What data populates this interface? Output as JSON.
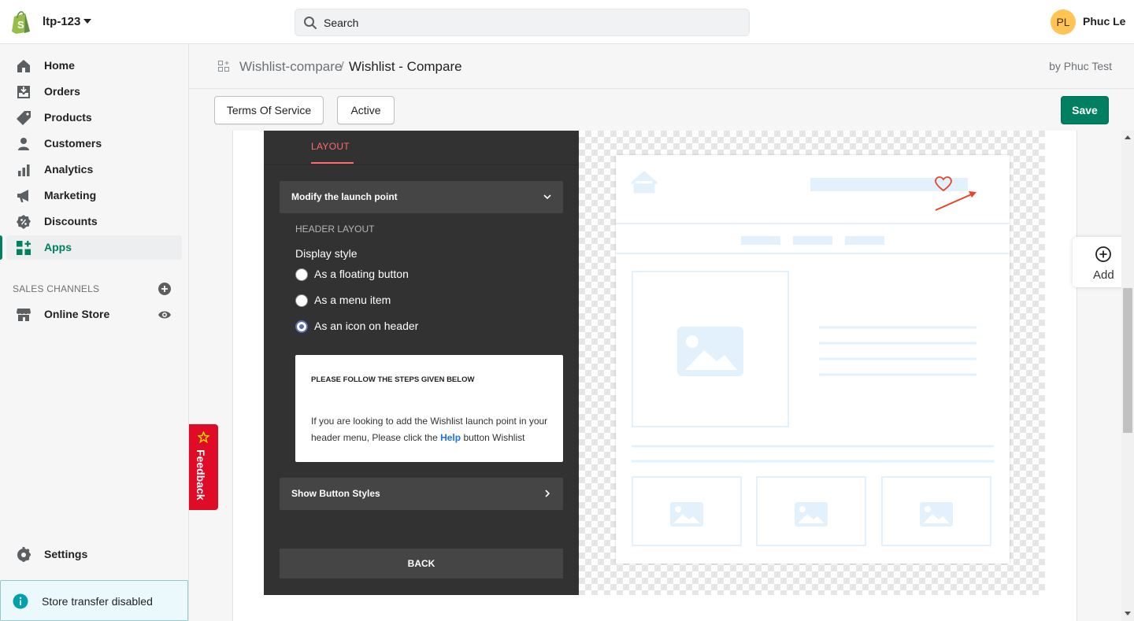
{
  "topbar": {
    "store_name": "ltp-123",
    "search_placeholder": "Search",
    "avatar_initials": "PL",
    "user_name": "Phuc Le",
    "icons": [
      "shopify-logo-icon",
      "caret-down-icon",
      "search-icon"
    ]
  },
  "sidebar": {
    "items": [
      {
        "label": "Home",
        "icon": "home-icon"
      },
      {
        "label": "Orders",
        "icon": "orders-icon"
      },
      {
        "label": "Products",
        "icon": "tag-icon"
      },
      {
        "label": "Customers",
        "icon": "person-icon"
      },
      {
        "label": "Analytics",
        "icon": "bar-chart-icon"
      },
      {
        "label": "Marketing",
        "icon": "megaphone-icon"
      },
      {
        "label": "Discounts",
        "icon": "discount-icon"
      },
      {
        "label": "Apps",
        "icon": "apps-icon",
        "active": true
      }
    ],
    "sales_channels_title": "SALES CHANNELS",
    "online_store": "Online Store",
    "settings": "Settings",
    "store_transfer": "Store transfer disabled"
  },
  "header": {
    "breadcrumb_parent": "Wishlist-compare",
    "breadcrumb_separator": "/",
    "breadcrumb_current": "Wishlist - Compare",
    "by_line": "by Phuc Test"
  },
  "toolbar": {
    "terms_label": "Terms Of Service",
    "active_label": "Active",
    "save_label": "Save"
  },
  "editor": {
    "tab_layout": "LAYOUT",
    "launch_point_title": "Modify the launch point",
    "header_layout": "HEADER LAYOUT",
    "display_style": "Display style",
    "options": [
      {
        "label": "As a floating button",
        "checked": false
      },
      {
        "label": "As a menu item",
        "checked": false
      },
      {
        "label": "As an icon on header",
        "checked": true
      }
    ],
    "info_title": "PLEASE FOLLOW THE STEPS GIVEN BELOW",
    "info_text_before": "If you are looking to add the Wishlist launch point in your header menu, Please click the ",
    "info_help": "Help",
    "info_text_after": " button Wishlist",
    "button_styles_title": "Show Button Styles",
    "back_label": "BACK"
  },
  "feedback": {
    "label": "Feedback"
  },
  "add_widget": {
    "label": "Add"
  },
  "colors": {
    "brand_green": "#008060",
    "editor_bg": "#323232",
    "accent_red": "#ff6b6b",
    "feedback_red": "#e00b27",
    "wireframe_blue": "#e3f1fc"
  }
}
